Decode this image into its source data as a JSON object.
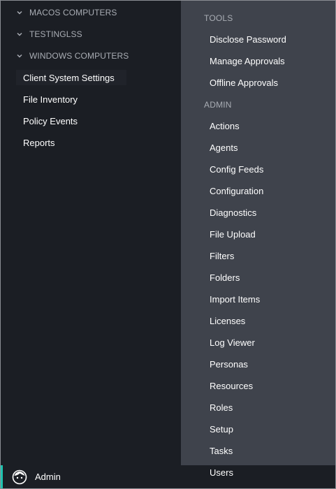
{
  "sidebar": {
    "groups": [
      {
        "label": "MACOS COMPUTERS",
        "icon": "chevron-down-icon"
      },
      {
        "label": "TESTINGLSS",
        "icon": "chevron-down-icon"
      },
      {
        "label": "WINDOWS COMPUTERS",
        "icon": "chevron-down-icon"
      }
    ],
    "items": [
      {
        "label": "Client System Settings"
      },
      {
        "label": "File Inventory"
      },
      {
        "label": "Policy Events"
      },
      {
        "label": "Reports"
      }
    ]
  },
  "menu": {
    "tools_title": "TOOLS",
    "tools": [
      {
        "label": "Disclose Password"
      },
      {
        "label": "Manage Approvals"
      },
      {
        "label": "Offline Approvals"
      }
    ],
    "admin_title": "ADMIN",
    "admin": [
      {
        "label": "Actions"
      },
      {
        "label": "Agents"
      },
      {
        "label": "Config Feeds"
      },
      {
        "label": "Configuration"
      },
      {
        "label": "Diagnostics"
      },
      {
        "label": "File Upload"
      },
      {
        "label": "Filters"
      },
      {
        "label": "Folders"
      },
      {
        "label": "Import Items"
      },
      {
        "label": "Licenses"
      },
      {
        "label": "Log Viewer"
      },
      {
        "label": "Personas"
      },
      {
        "label": "Resources"
      },
      {
        "label": "Roles"
      },
      {
        "label": "Setup"
      },
      {
        "label": "Tasks"
      },
      {
        "label": "Users"
      }
    ]
  },
  "footer": {
    "label": "Admin",
    "icon": "user-avatar-icon"
  },
  "colors": {
    "accent": "#1fc3b0",
    "sidebar_bg": "#1b1e24",
    "menu_bg": "#3f434c"
  }
}
